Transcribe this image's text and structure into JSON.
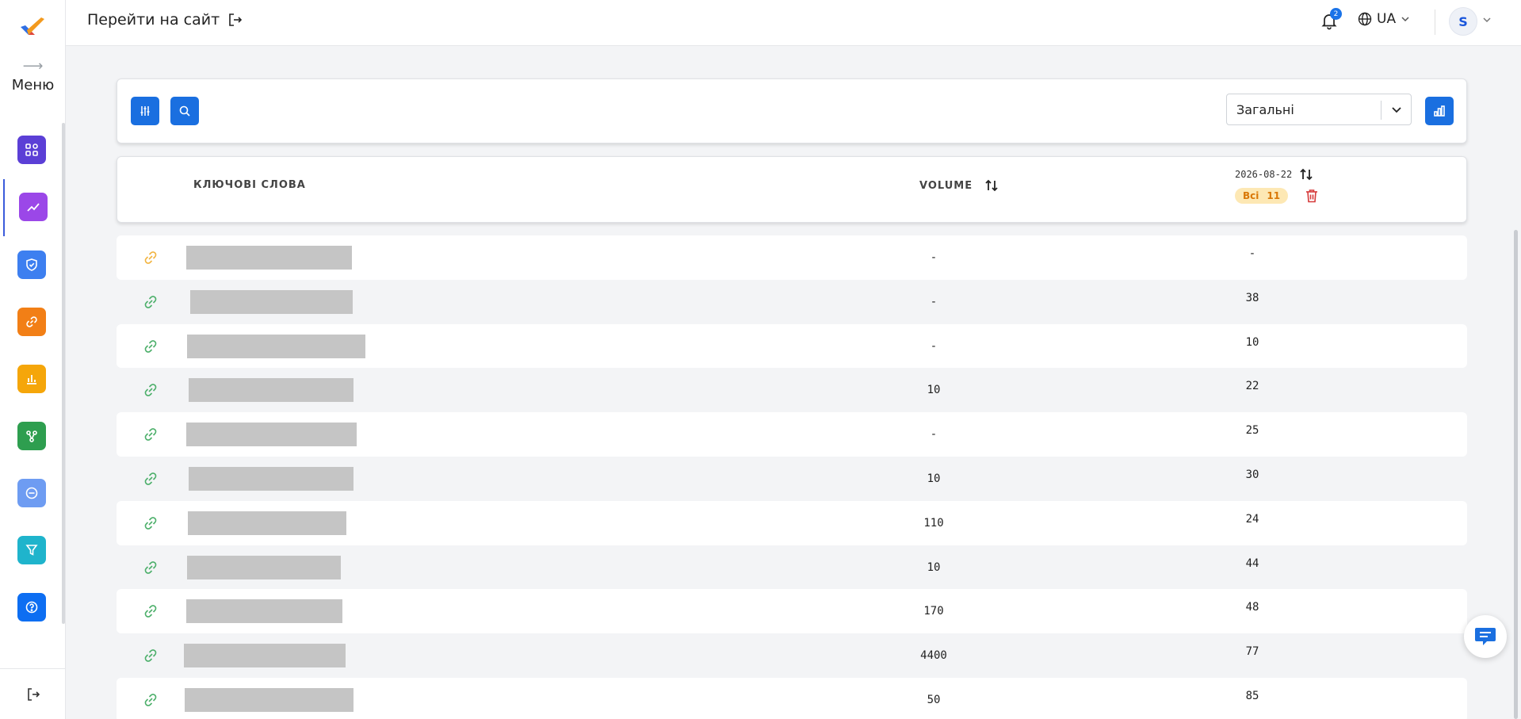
{
  "sidebar": {
    "menu_label": "Меню",
    "items": [
      {
        "name": "dashboard-icon",
        "color": "#5b3fd6"
      },
      {
        "name": "trend-icon",
        "color": "#9b47e8"
      },
      {
        "name": "shield-check-icon",
        "color": "#3d7ff0"
      },
      {
        "name": "link-icon",
        "color": "#f27f16"
      },
      {
        "name": "bar-chart-icon",
        "color": "#f5a60a"
      },
      {
        "name": "share-nodes-icon",
        "color": "#2e9e4f"
      },
      {
        "name": "minus-circle-icon",
        "color": "#6e9cf2"
      },
      {
        "name": "filter-icon",
        "color": "#1fb4cc"
      },
      {
        "name": "help-circle-icon",
        "color": "#0d6ef2"
      }
    ]
  },
  "header": {
    "goto_site": "Перейти на сайт",
    "notification_count": "2",
    "language": "UA",
    "avatar_initial": "S"
  },
  "toolbar": {
    "group_select_value": "Загальні"
  },
  "table": {
    "col_keywords": "КЛЮЧОВІ СЛОВА",
    "col_volume": "VOLUME",
    "col_date": "2026-08-22",
    "badge_label": "Всі",
    "badge_count": "11",
    "rows": [
      {
        "volume": "-",
        "position": "-",
        "link_color": "#f2b441"
      },
      {
        "volume": "-",
        "position": "38",
        "link_color": "#4caf6a"
      },
      {
        "volume": "-",
        "position": "10",
        "link_color": "#4caf6a"
      },
      {
        "volume": "10",
        "position": "22",
        "link_color": "#4caf6a"
      },
      {
        "volume": "-",
        "position": "25",
        "link_color": "#4caf6a"
      },
      {
        "volume": "10",
        "position": "30",
        "link_color": "#4caf6a"
      },
      {
        "volume": "110",
        "position": "24",
        "link_color": "#4caf6a"
      },
      {
        "volume": "10",
        "position": "44",
        "link_color": "#4caf6a"
      },
      {
        "volume": "170",
        "position": "48",
        "link_color": "#4caf6a"
      },
      {
        "volume": "4400",
        "position": "77",
        "link_color": "#4caf6a"
      },
      {
        "volume": "50",
        "position": "85",
        "link_color": "#4caf6a"
      }
    ]
  }
}
